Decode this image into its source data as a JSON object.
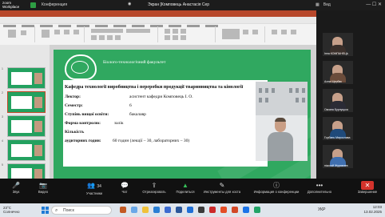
{
  "zoom": {
    "logo_line1": "zoom",
    "logo_line2": "Workplace",
    "conference_label": "Конференция",
    "showing_label": "Экран [Комповець Анастасія Сер",
    "view_label": "Вид",
    "win_controls": "—  ☐  ✕"
  },
  "slide": {
    "faculty": "Біолого-технологічний факультет",
    "department": "Кафедра технології виробництва і переробки продукції тваринництва та кінології",
    "rows": [
      {
        "key": "Лектор:",
        "value": "асистент кафедри Комповець І. О."
      },
      {
        "key": "Семестр:",
        "value": "6"
      },
      {
        "key": "Ступінь вищої освіти:",
        "value": "бакалавр"
      },
      {
        "key": "Форма контролю:",
        "value": "залік"
      },
      {
        "key": "Кількість",
        "value": ""
      },
      {
        "key": "аудиторних годин:",
        "value": "60 годин (лекції – 30,  лабораторних – 30)"
      }
    ]
  },
  "participants": [
    {
      "label": "Інна КОМПАНЕЦЬ"
    },
    {
      "label": "Алла Щербак"
    },
    {
      "label": "Оксана Бурлуцька"
    },
    {
      "label": "Горбань Мирослава"
    },
    {
      "label": "ніколай Журавлев"
    }
  ],
  "controls": [
    {
      "glyph": "🎤",
      "label": "Звук"
    },
    {
      "glyph": "📷",
      "label": "Видео"
    },
    {
      "glyph": "👥",
      "label": "Участники",
      "count": "34"
    },
    {
      "glyph": "💬",
      "label": "Чат"
    },
    {
      "glyph": "⇪",
      "label": "Отреагировать"
    },
    {
      "glyph": "▲",
      "label": "Поделиться"
    },
    {
      "glyph": "✎",
      "label": "Инструменты для хоста"
    },
    {
      "glyph": "ⓘ",
      "label": "Информация о конференции"
    },
    {
      "glyph": "•••",
      "label": "Дополнительно"
    },
    {
      "glyph": "✕",
      "label": "Завершение"
    }
  ],
  "taskbar": {
    "weather_temp": "23°C",
    "weather_text": "Солнечно",
    "search_placeholder": "Поиск",
    "lang": "УКР",
    "time": "12:03",
    "date": "13.02.2025"
  },
  "colors": {
    "accent_green": "#30a860",
    "ppt_red": "#b7472a",
    "end_red": "#d4332c"
  }
}
